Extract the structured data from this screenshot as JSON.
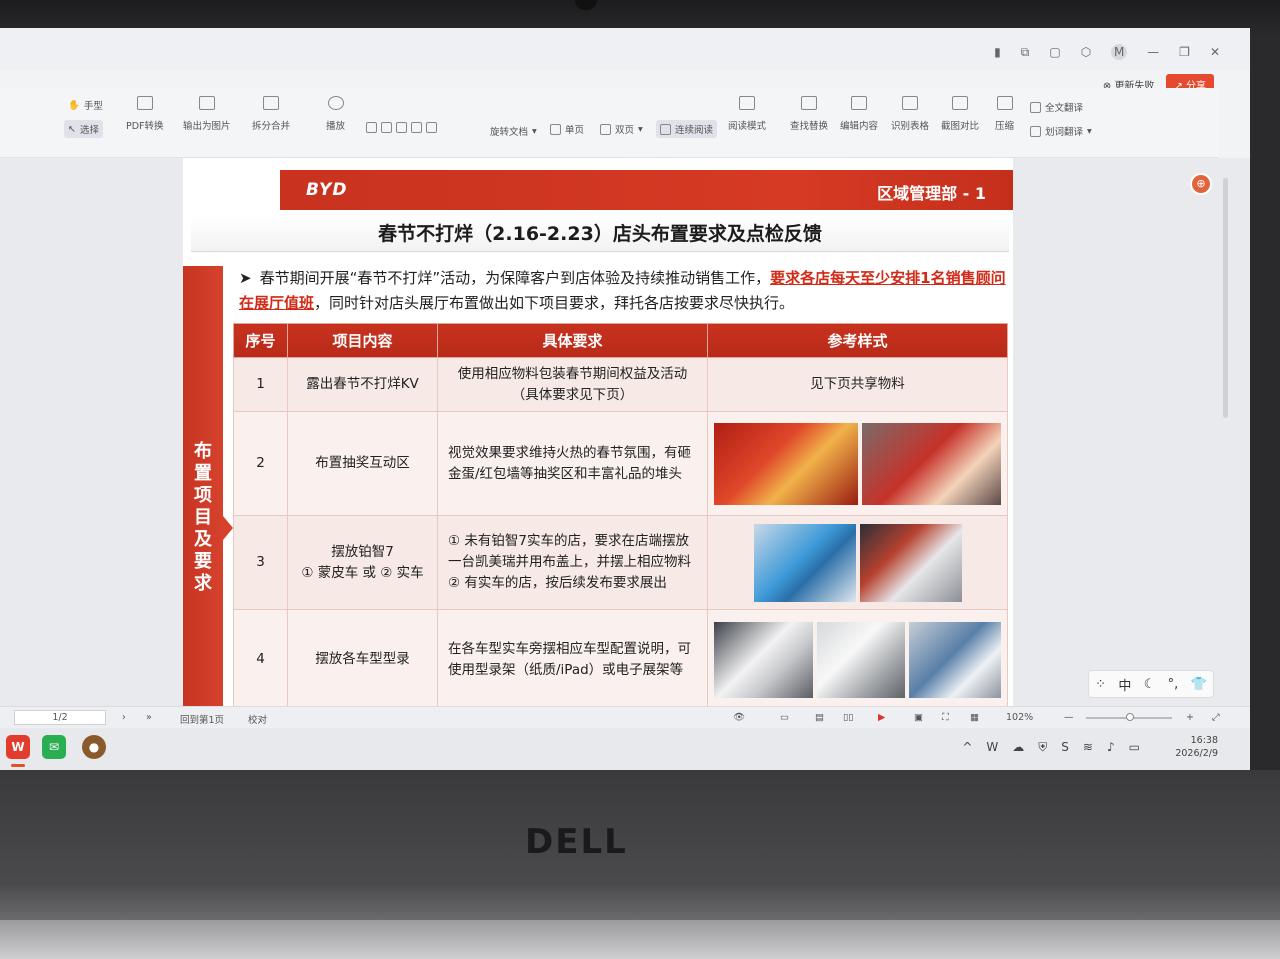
{
  "window": {
    "update_label": "更新失败",
    "share_label": "分享",
    "avatar_letter": "M"
  },
  "ribbon": {
    "hand": "手型",
    "select": "选择",
    "pdf_convert": "PDF转换",
    "export_image": "输出为图片",
    "split_merge": "拆分合并",
    "play": "播放",
    "rotate_doc": "旋转文档",
    "single_page": "单页",
    "double_page": "双页",
    "continuous_read": "连续阅读",
    "read_mode": "阅读模式",
    "find_replace": "查找替换",
    "edit_content": "编辑内容",
    "recognize_table": "识别表格",
    "screenshot_compare": "截图对比",
    "compress": "压缩",
    "full_translate": "全文翻译",
    "word_translate": "划词翻译"
  },
  "slide": {
    "logo": "BYD",
    "dept": "区域管理部 - 1",
    "title": "春节不打烊（2.16-2.23）店头布置要求及点检反馈",
    "side_label": "布置项目及要求",
    "intro_part1": "春节期间开展“春节不打烊”活动，为保障客户到店体验及持续推动销售工作，",
    "intro_highlight1": "要求各店每天至少安排",
    "intro_highlight2": "1名销售顾问在展厅值班",
    "intro_part2": "，同时针对店头展厅布置做出如下项目要求，拜托各店按要求尽快执行。",
    "headers": [
      "序号",
      "项目内容",
      "具体要求",
      "参考样式"
    ],
    "rows": [
      {
        "no": "1",
        "item": "露出春节不打烊KV",
        "req_lines": [
          "使用相应物料包装春节期间权益及活动",
          "（具体要求见下页）"
        ],
        "ref": "见下页共享物料"
      },
      {
        "no": "2",
        "item": "布置抽奖互动区",
        "req_lines": [
          "视觉效果要求维持火热的春节氛围，有砸",
          "金蛋/红包墙等抽奖区和丰富礼品的堆头"
        ]
      },
      {
        "no": "3",
        "item_lines": [
          "摆放铂智7",
          "① 蒙皮车 或 ② 实车"
        ],
        "req_lines": [
          "① 未有铂智7实车的店，要求在店端摆放",
          "一台凯美瑞并用布盖上，并摆上相应物料",
          "② 有实车的店，按后续发布要求展出"
        ]
      },
      {
        "no": "4",
        "item": "摆放各车型型录",
        "req_lines": [
          "在各车型实车旁摆相应车型配置说明，可",
          "使用型录架（纸质/iPad）或电子展架等"
        ]
      }
    ]
  },
  "statusbar": {
    "page": "1/2",
    "back_to_first": "回到第1页",
    "proofread": "校对",
    "zoom": "102%"
  },
  "ime": {
    "mode": "中"
  },
  "taskbar": {
    "time": "16:38",
    "date": "2026/2/9"
  },
  "bezel": {
    "brand": "DELL"
  }
}
